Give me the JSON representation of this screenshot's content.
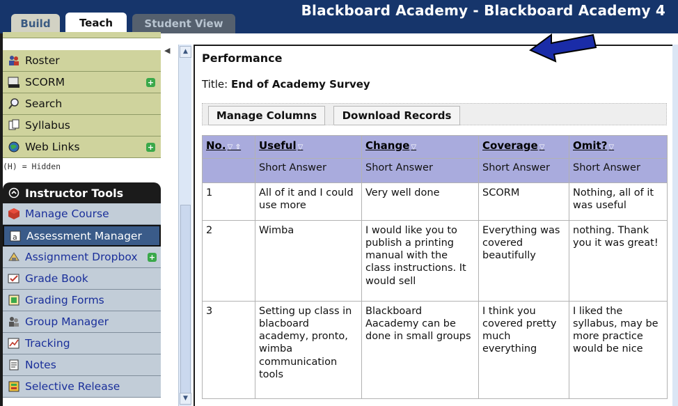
{
  "tabs": {
    "build": "Build",
    "teach": "Teach",
    "student_view": "Student View"
  },
  "app_title": "Blackboard Academy - Blackboard Academy 4",
  "sidebar": {
    "items": [
      {
        "label": "Roster",
        "icon": "people-icon"
      },
      {
        "label": "SCORM",
        "icon": "scorm-icon",
        "badge": "+"
      },
      {
        "label": "Search",
        "icon": "magnifier-icon"
      },
      {
        "label": "Syllabus",
        "icon": "syllabus-icon"
      },
      {
        "label": "Web Links",
        "icon": "globe-icon",
        "badge": "+"
      }
    ],
    "hidden_note": "(H) = Hidden",
    "instructor_tools_title": "Instructor Tools",
    "tools": [
      {
        "label": "Manage Course",
        "icon": "cube-icon"
      },
      {
        "label": "Assessment Manager",
        "icon": "assessment-icon",
        "active": true
      },
      {
        "label": "Assignment Dropbox",
        "icon": "dropbox-icon",
        "badge": "+"
      },
      {
        "label": "Grade Book",
        "icon": "gradebook-icon"
      },
      {
        "label": "Grading Forms",
        "icon": "grading-forms-icon"
      },
      {
        "label": "Group Manager",
        "icon": "group-icon"
      },
      {
        "label": "Tracking",
        "icon": "tracking-icon"
      },
      {
        "label": "Notes",
        "icon": "notes-icon"
      },
      {
        "label": "Selective Release",
        "icon": "release-icon"
      }
    ]
  },
  "main": {
    "heading": "Performance",
    "title_label": "Title:",
    "title_value": "End of Academy Survey",
    "buttons": {
      "manage": "Manage Columns",
      "download": "Download Records"
    },
    "table": {
      "headers": [
        "No.",
        "Useful",
        "Change",
        "Coverage",
        "Omit?"
      ],
      "types": [
        "",
        "Short Answer",
        "Short Answer",
        "Short Answer",
        "Short Answer"
      ],
      "rows": [
        [
          "1",
          "All of it and I could use more",
          "Very well done",
          "SCORM",
          "Nothing, all of it was useful"
        ],
        [
          "2",
          "Wimba",
          "I would like you to publish a printing manual with the class instructions. It would sell",
          "Everything was covered beautifully",
          "nothing. Thank you it was great!"
        ],
        [
          "3",
          "Setting up class in blacboard academy, pronto, wimba communication tools",
          "Blackboard Aacademy can be done in small groups",
          "I think you covered pretty much everything",
          "I liked the syllabus, may be more practice would be nice"
        ]
      ]
    }
  },
  "colors": {
    "topbar": "#16356b",
    "nav": "#cfd39d",
    "tools": "#c2cdd8",
    "table_header": "#a9abdd",
    "arrow": "#1a2ca8"
  }
}
